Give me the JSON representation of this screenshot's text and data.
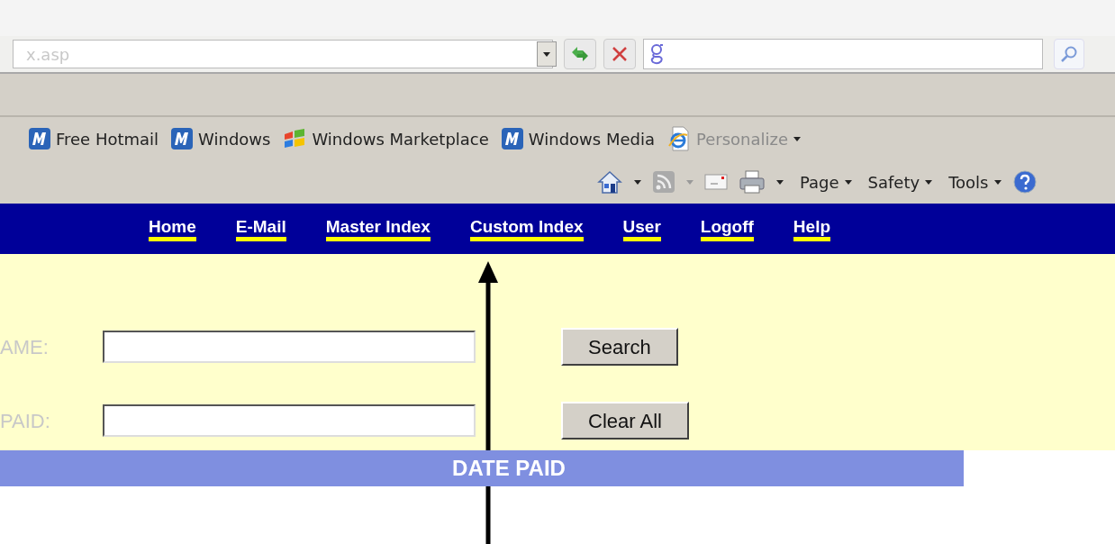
{
  "address_bar": {
    "value": "x.asp"
  },
  "favorites": [
    {
      "label": "Free Hotmail",
      "kind": "msn"
    },
    {
      "label": "Windows",
      "kind": "msn"
    },
    {
      "label": "Windows Marketplace",
      "kind": "flag"
    },
    {
      "label": "Windows Media",
      "kind": "msn"
    },
    {
      "label": "Personalize",
      "kind": "ie",
      "disabled": true
    }
  ],
  "command_bar": [
    {
      "label": "Page"
    },
    {
      "label": "Safety"
    },
    {
      "label": "Tools"
    }
  ],
  "nav_links": [
    {
      "label": "Home"
    },
    {
      "label": "E-Mail"
    },
    {
      "label": "Master Index"
    },
    {
      "label": "Custom Index"
    },
    {
      "label": "User"
    },
    {
      "label": "Logoff"
    },
    {
      "label": "Help"
    }
  ],
  "form_rows": [
    {
      "label": "AME:",
      "button": "Search"
    },
    {
      "label": "PAID:",
      "button": "Clear All"
    }
  ],
  "table": {
    "columns": [
      "DATE PAID"
    ]
  }
}
